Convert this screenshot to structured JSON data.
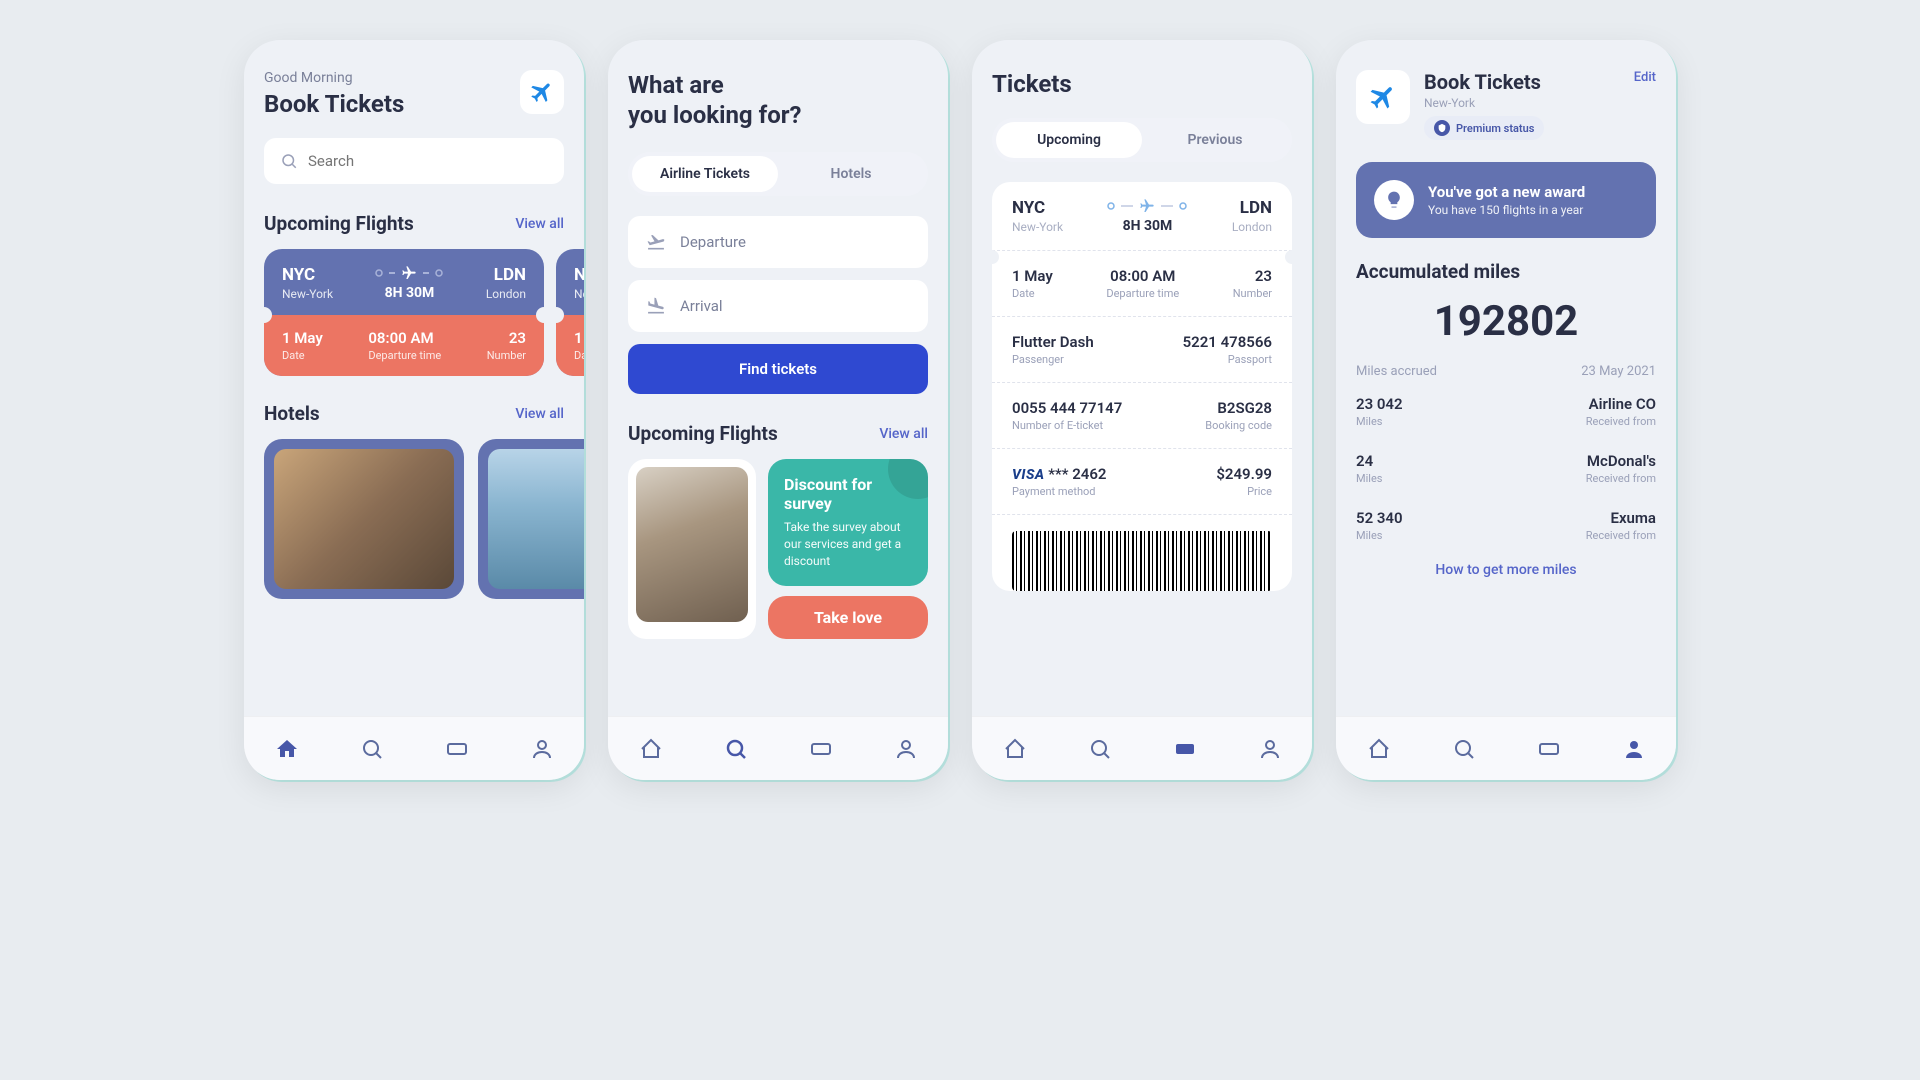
{
  "screen1": {
    "greeting": "Good Morning",
    "title": "Book Tickets",
    "search_placeholder": "Search",
    "upcoming_label": "Upcoming Flights",
    "view_all": "View all",
    "flight": {
      "from_code": "NYC",
      "from_city": "New-York",
      "to_code": "LDN",
      "to_city": "London",
      "duration": "8H 30M",
      "date": "1 May",
      "date_lbl": "Date",
      "time": "08:00 AM",
      "time_lbl": "Departure time",
      "num": "23",
      "num_lbl": "Number"
    },
    "hotels_label": "Hotels"
  },
  "screen2": {
    "heading": "What are\nyou looking for?",
    "tabs": {
      "airline": "Airline Tickets",
      "hotels": "Hotels"
    },
    "departure": "Departure",
    "arrival": "Arrival",
    "find": "Find tickets",
    "upcoming_label": "Upcoming Flights",
    "view_all": "View all",
    "promo": {
      "title": "Discount for survey",
      "text": "Take the survey about our services and get a discount",
      "take_love": "Take love"
    }
  },
  "screen3": {
    "title": "Tickets",
    "tabs": {
      "upcoming": "Upcoming",
      "previous": "Previous"
    },
    "route": {
      "from_code": "NYC",
      "from_city": "New-York",
      "to_code": "LDN",
      "to_city": "London",
      "duration": "8H 30M"
    },
    "r1": {
      "date": "1 May",
      "date_lbl": "Date",
      "time": "08:00 AM",
      "time_lbl": "Departure time",
      "num": "23",
      "num_lbl": "Number"
    },
    "r2": {
      "name": "Flutter Dash",
      "name_lbl": "Passenger",
      "pass": "5221 478566",
      "pass_lbl": "Passport"
    },
    "r3": {
      "eticket": "0055 444 77147",
      "eticket_lbl": "Number of E-ticket",
      "code": "B2SG28",
      "code_lbl": "Booking code"
    },
    "r4": {
      "visa": "VISA",
      "card": " *** 2462",
      "pay_lbl": "Payment method",
      "price": "$249.99",
      "price_lbl": "Price"
    }
  },
  "screen4": {
    "title": "Book Tickets",
    "sub": "New-York",
    "badge": "Premium status",
    "edit": "Edit",
    "award_title": "You've got a new award",
    "award_sub": "You have 150 flights in a year",
    "miles_title": "Accumulated miles",
    "miles_total": "192802",
    "accrued_lbl": "Miles accrued",
    "accrued_date": "23 May 2021",
    "rows": [
      {
        "miles": "23 042",
        "from": "Airline CO"
      },
      {
        "miles": "24",
        "from": "McDonal's"
      },
      {
        "miles": "52 340",
        "from": "Exuma"
      }
    ],
    "miles_lbl": "Miles",
    "from_lbl": "Received from",
    "link": "How to get more miles"
  }
}
